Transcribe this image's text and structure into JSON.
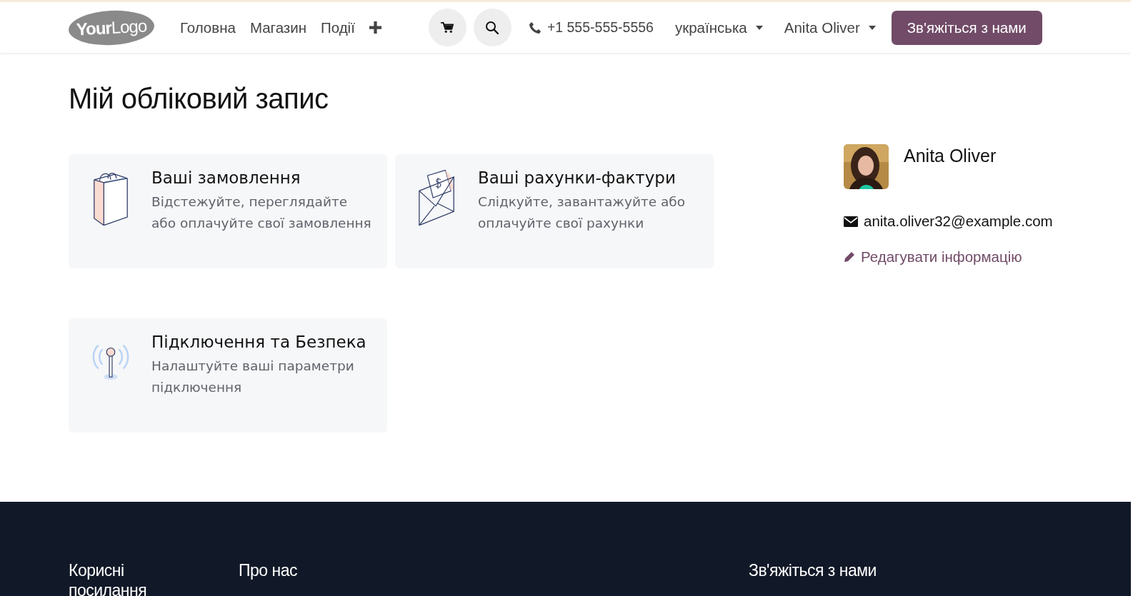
{
  "header": {
    "logo": {
      "first": "Your",
      "second": "Logo"
    },
    "nav": [
      {
        "label": "Головна"
      },
      {
        "label": "Магазин"
      },
      {
        "label": "Події"
      }
    ],
    "phone": "+1 555-555-5556",
    "language": "українська",
    "user": "Anita Oliver",
    "contact_button": "Зв'яжіться з нами"
  },
  "page_title": "Мій обліковий запис",
  "cards": [
    {
      "kind": "orders",
      "title": "Ваші замовлення",
      "description": "Відстежуйте, переглядайте або оплачуйте свої замовлення"
    },
    {
      "kind": "invoices",
      "title": "Ваші рахунки-фактури",
      "description": "Слідкуйте, завантажуйте або оплачуйте свої рахунки"
    },
    {
      "kind": "security",
      "title": "Підключення та Безпека",
      "description": "Налаштуйте ваші параметри підключення"
    }
  ],
  "profile": {
    "name": "Anita Oliver",
    "email": "anita.oliver32@example.com",
    "edit_link": "Редагувати інформацію"
  },
  "footer": {
    "headings": [
      {
        "text": "Корисні посилання"
      },
      {
        "text": "Про нас"
      },
      {
        "text": "Зв'яжіться з нами"
      }
    ]
  }
}
